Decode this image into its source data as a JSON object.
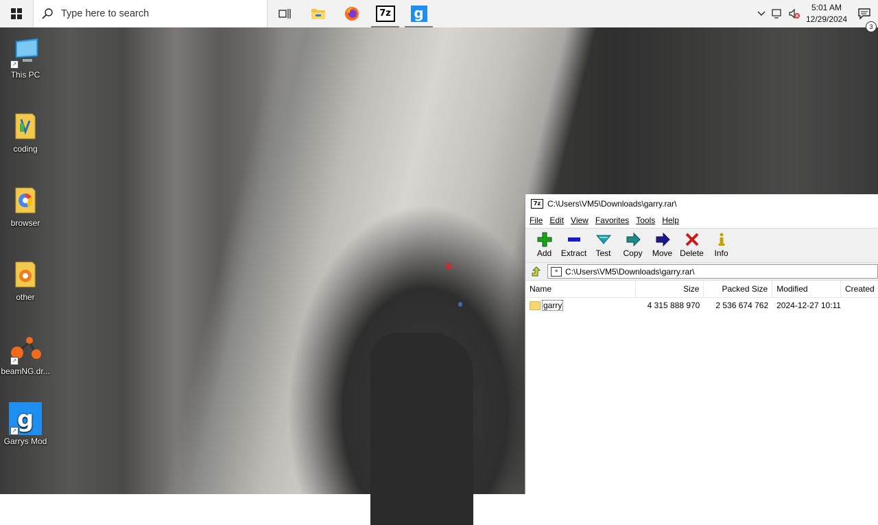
{
  "taskbar": {
    "search_placeholder": "Type here to search",
    "apps": [
      {
        "name": "task-view",
        "active": false
      },
      {
        "name": "file-explorer",
        "active": false
      },
      {
        "name": "firefox",
        "active": false
      },
      {
        "name": "7zip",
        "active": true,
        "label": "7z"
      },
      {
        "name": "garrys-mod",
        "active": true,
        "label": "g"
      }
    ],
    "clock": {
      "time": "5:01 AM",
      "date": "12/29/2024"
    },
    "notifications_count": "3"
  },
  "desktop": {
    "icons": [
      {
        "label": "This PC",
        "icon": "computer-icon"
      },
      {
        "label": "coding",
        "icon": "folder-icon"
      },
      {
        "label": "browser",
        "icon": "folder-icon"
      },
      {
        "label": "other",
        "icon": "folder-icon"
      },
      {
        "label": "beamNG.dr...",
        "icon": "beamng-icon"
      },
      {
        "label": "Garrys Mod",
        "icon": "gmod-icon"
      }
    ]
  },
  "window": {
    "title": "C:\\Users\\VM5\\Downloads\\garry.rar\\",
    "menu": [
      "File",
      "Edit",
      "View",
      "Favorites",
      "Tools",
      "Help"
    ],
    "toolbar": [
      {
        "label": "Add",
        "icon": "add-icon",
        "color": "#1aa31a"
      },
      {
        "label": "Extract",
        "icon": "extract-icon",
        "color": "#1a1acc"
      },
      {
        "label": "Test",
        "icon": "test-icon",
        "color": "#1aa3b3"
      },
      {
        "label": "Copy",
        "icon": "copy-icon",
        "color": "#1a8a8a"
      },
      {
        "label": "Move",
        "icon": "move-icon",
        "color": "#1a1a8c"
      },
      {
        "label": "Delete",
        "icon": "delete-icon",
        "color": "#cc1a1a"
      },
      {
        "label": "Info",
        "icon": "info-icon",
        "color": "#c8a000"
      }
    ],
    "address": "C:\\Users\\VM5\\Downloads\\garry.rar\\",
    "columns": {
      "name": "Name",
      "size": "Size",
      "packed": "Packed Size",
      "modified": "Modified",
      "created": "Created"
    },
    "rows": [
      {
        "name": "garry",
        "size": "4 315 888 970",
        "packed": "2 536 674 762",
        "modified": "2024-12-27 10:11",
        "created": ""
      }
    ]
  }
}
